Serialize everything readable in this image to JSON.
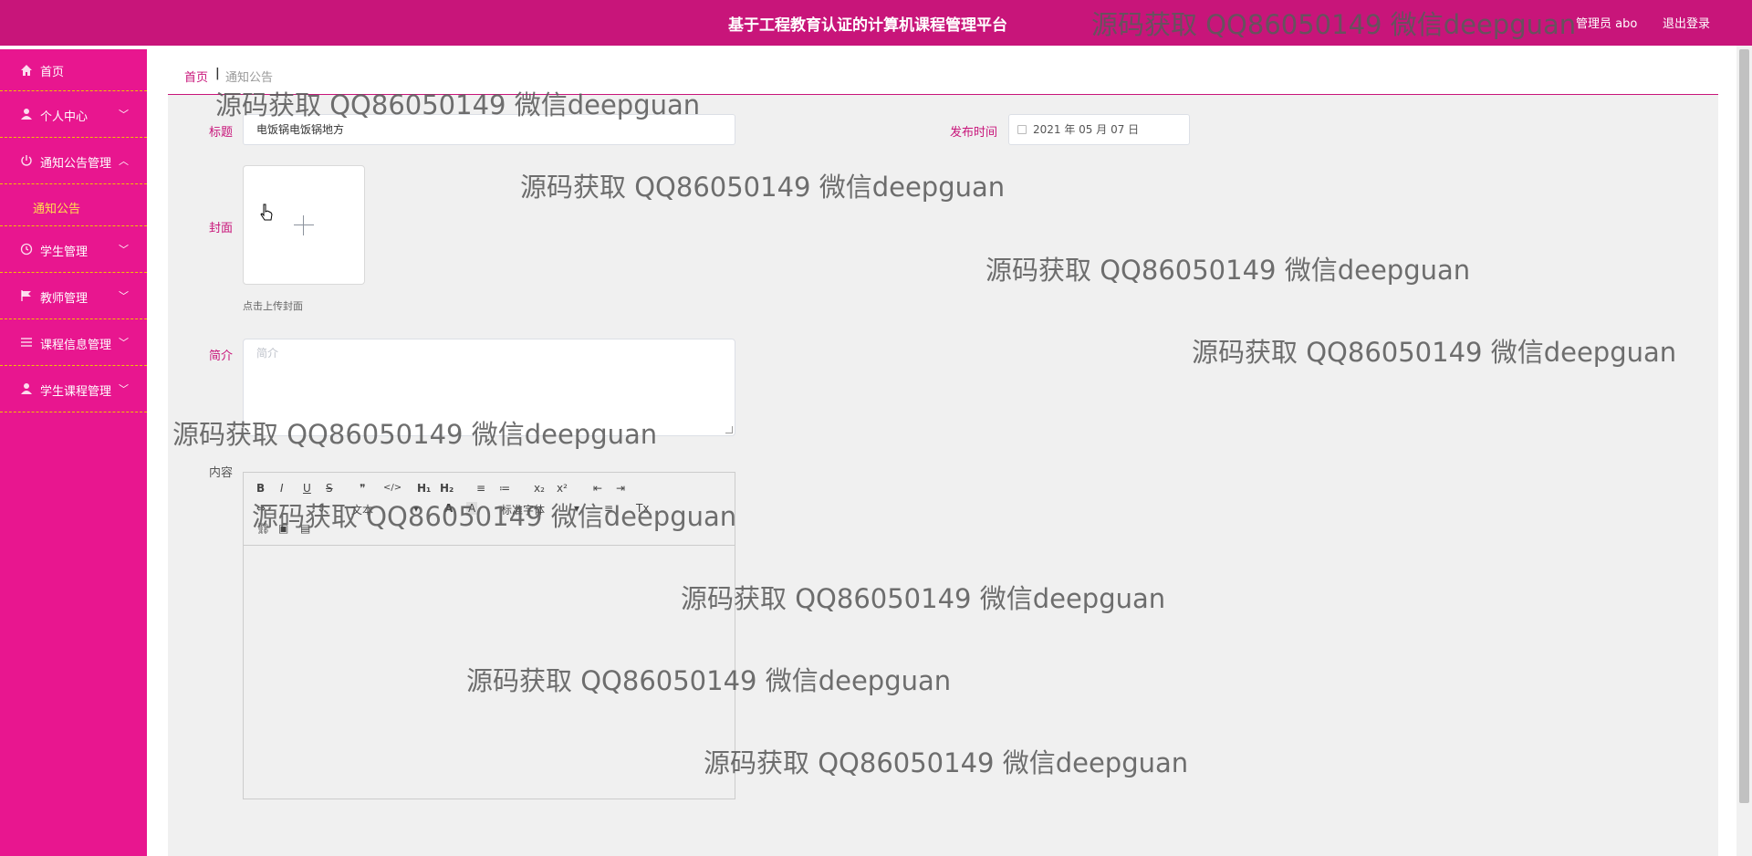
{
  "header": {
    "title": "基于工程教育认证的计算机课程管理平台",
    "user": "管理员 abo",
    "logout": "退出登录"
  },
  "sidebar": {
    "items": [
      {
        "label": "首页",
        "icon": "home-icon"
      },
      {
        "label": "个人中心",
        "icon": "user-icon"
      },
      {
        "label": "通知公告管理",
        "icon": "power-icon"
      },
      {
        "label": "通知公告",
        "icon": ""
      },
      {
        "label": "学生管理",
        "icon": "clock-icon"
      },
      {
        "label": "教师管理",
        "icon": "flag-icon"
      },
      {
        "label": "课程信息管理",
        "icon": "list-icon"
      },
      {
        "label": "学生课程管理",
        "icon": "user-icon"
      }
    ],
    "active_color": "#ffe14d"
  },
  "breadcrumb": {
    "home": "首页",
    "separator": "|",
    "current": "通知公告"
  },
  "form": {
    "title_label": "标题",
    "title_value": "电饭锅电饭锅地方",
    "date_label": "发布时间",
    "date_value": "2021 年 05 月 07 日",
    "cover_label": "封面",
    "cover_tip": "点击上传封面",
    "intro_label": "简介",
    "intro_placeholder": "简介",
    "content_label": "内容"
  },
  "editor_toolbar": {
    "row1": [
      "B",
      "I",
      "U",
      "S",
      "❞",
      "</>",
      "H₁",
      "H₂",
      "≡",
      "≔",
      "x₂",
      "x²",
      "⇤",
      "⇥"
    ],
    "row2": [
      "⇔",
      "⇕",
      "文本",
      "▾",
      "A",
      "A",
      "标准字体",
      "▾",
      "≡",
      "Tx"
    ],
    "row3": [
      "⛓",
      "▣",
      "▤"
    ]
  },
  "watermark": "源码获取 QQ86050149 微信deepguan",
  "colors": {
    "header": "#c8157a",
    "sidebar": "#e8168f",
    "divider": "#f2c200",
    "label": "#c8157a"
  }
}
